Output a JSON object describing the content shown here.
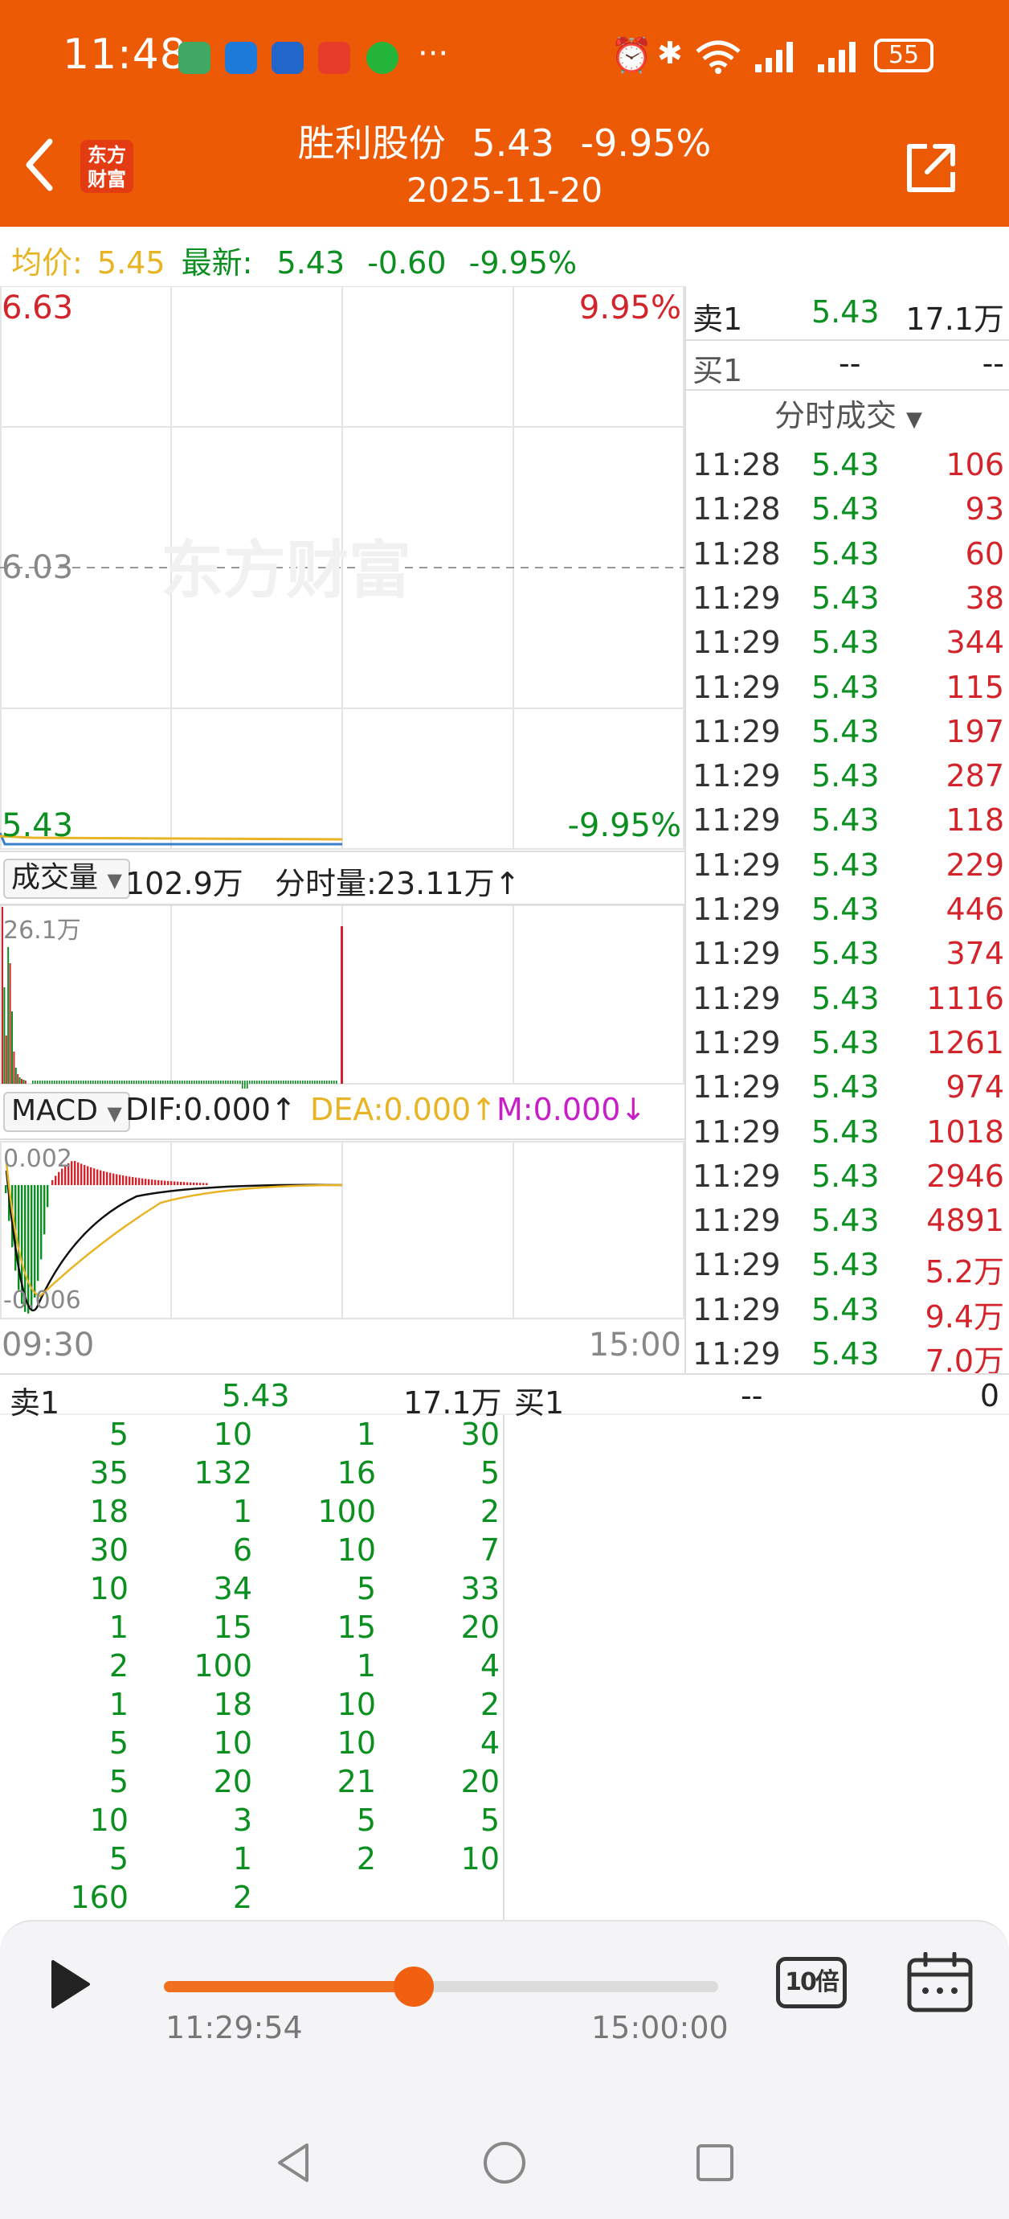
{
  "status_bar": {
    "time": "11:48",
    "more": "···",
    "battery": "55"
  },
  "header": {
    "logo_line1": "东方",
    "logo_line2": "财富",
    "stock_name": "胜利股份",
    "price": "5.43",
    "change_pct": "-9.95%",
    "date": "2025-11-20"
  },
  "info_line": {
    "avg_label": "均价:",
    "avg_value": "5.45",
    "latest_label": "最新:",
    "latest_value": "5.43",
    "change": "-0.60",
    "change_pct": "-9.95%"
  },
  "price_chart": {
    "high_price": "6.63",
    "high_pct": "9.95%",
    "mid_price": "6.03",
    "low_price": "5.43",
    "low_pct": "-9.95%",
    "watermark": "东方财富"
  },
  "volume": {
    "dropdown": "成交量",
    "total": "102.9万",
    "minute_label": "分时量:23.11万↑",
    "max_label": "26.1万"
  },
  "macd": {
    "dropdown": "MACD",
    "dif": "DIF:0.000↑",
    "dea": "DEA:0.000↑",
    "m": "M:0.000↓",
    "top_label": "0.002",
    "bottom_label": "-0.006",
    "time_start": "09:30",
    "time_end": "15:00"
  },
  "right_panel": {
    "sell1_label": "卖1",
    "sell1_price": "5.43",
    "sell1_vol": "17.1万",
    "buy1_label": "买1",
    "buy1_price": "--",
    "buy1_vol": "--",
    "trades_title": "分时成交",
    "trades": [
      {
        "time": "11:28",
        "price": "5.43",
        "vol": "106"
      },
      {
        "time": "11:28",
        "price": "5.43",
        "vol": "93"
      },
      {
        "time": "11:28",
        "price": "5.43",
        "vol": "60"
      },
      {
        "time": "11:29",
        "price": "5.43",
        "vol": "38"
      },
      {
        "time": "11:29",
        "price": "5.43",
        "vol": "344"
      },
      {
        "time": "11:29",
        "price": "5.43",
        "vol": "115"
      },
      {
        "time": "11:29",
        "price": "5.43",
        "vol": "197"
      },
      {
        "time": "11:29",
        "price": "5.43",
        "vol": "287"
      },
      {
        "time": "11:29",
        "price": "5.43",
        "vol": "118"
      },
      {
        "time": "11:29",
        "price": "5.43",
        "vol": "229"
      },
      {
        "time": "11:29",
        "price": "5.43",
        "vol": "446"
      },
      {
        "time": "11:29",
        "price": "5.43",
        "vol": "374"
      },
      {
        "time": "11:29",
        "price": "5.43",
        "vol": "1116"
      },
      {
        "time": "11:29",
        "price": "5.43",
        "vol": "1261"
      },
      {
        "time": "11:29",
        "price": "5.43",
        "vol": "974"
      },
      {
        "time": "11:29",
        "price": "5.43",
        "vol": "1018"
      },
      {
        "time": "11:29",
        "price": "5.43",
        "vol": "2946"
      },
      {
        "time": "11:29",
        "price": "5.43",
        "vol": "4891"
      },
      {
        "time": "11:29",
        "price": "5.43",
        "vol": "5.2万"
      },
      {
        "time": "11:29",
        "price": "5.43",
        "vol": "9.4万"
      },
      {
        "time": "11:29",
        "price": "5.43",
        "vol": "7.0万"
      }
    ]
  },
  "queue": {
    "sell_label": "卖1",
    "sell_price": "5.43",
    "sell_vol": "17.1万",
    "buy_label": "买1",
    "buy_price": "--",
    "buy_vol": "0",
    "rows": [
      [
        "5",
        "10",
        "1",
        "30"
      ],
      [
        "35",
        "132",
        "16",
        "5"
      ],
      [
        "18",
        "1",
        "100",
        "2"
      ],
      [
        "30",
        "6",
        "10",
        "7"
      ],
      [
        "10",
        "34",
        "5",
        "33"
      ],
      [
        "1",
        "15",
        "15",
        "20"
      ],
      [
        "2",
        "100",
        "1",
        "4"
      ],
      [
        "1",
        "18",
        "10",
        "2"
      ],
      [
        "5",
        "10",
        "10",
        "4"
      ],
      [
        "5",
        "20",
        "21",
        "20"
      ],
      [
        "10",
        "3",
        "5",
        "5"
      ],
      [
        "5",
        "1",
        "2",
        "10"
      ],
      [
        "160",
        "2",
        "",
        ""
      ]
    ]
  },
  "player": {
    "current_time": "11:29:54",
    "end_time": "15:00:00",
    "speed_label": "10倍",
    "progress": 0.45
  },
  "colors": {
    "header_bg": "#ec5a06",
    "up_red": "#d3242b",
    "down_green": "#0a8f20",
    "avg_yellow": "#e8b423"
  }
}
